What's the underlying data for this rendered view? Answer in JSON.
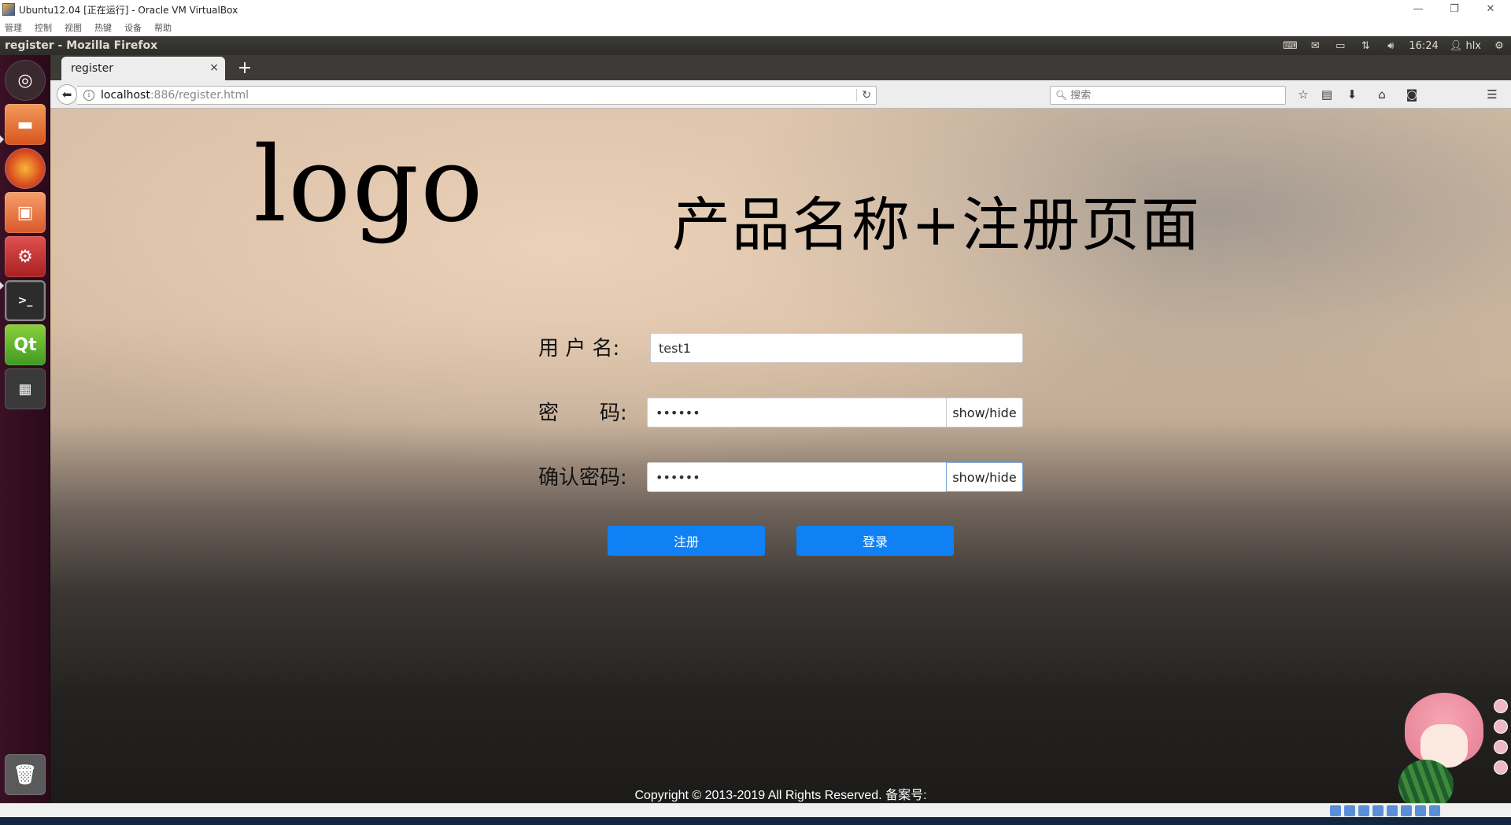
{
  "vbox": {
    "title": "Ubuntu12.04 [正在运行] - Oracle VM VirtualBox",
    "menu": [
      "管理",
      "控制",
      "视图",
      "热键",
      "设备",
      "帮助"
    ],
    "win_min": "—",
    "win_restore": "❐",
    "win_close": "✕"
  },
  "panel": {
    "window_title": "register - Mozilla Firefox",
    "clock": "16:24",
    "user": "hlx"
  },
  "browser": {
    "tab_title": "register",
    "tab_close": "×",
    "new_tab": "+",
    "url_host": "localhost",
    "url_path": ":886/register.html",
    "search_placeholder": "搜索"
  },
  "page": {
    "logo": "logo",
    "heading": "产品名称+注册页面",
    "form": {
      "username_label": "用 户 名:",
      "username_value": "test1",
      "password_label": "密　　码:",
      "password_value": "••••••",
      "confirm_label": "确认密码:",
      "confirm_value": "••••••",
      "toggle_label": "show/hide",
      "register_button": "注册",
      "login_button": "登录"
    },
    "footer": "Copyright © 2013-2019 All Rights Reserved. 备案号:"
  },
  "icons": {
    "back": "back-arrow-icon",
    "info": "info-icon",
    "reload": "reload-icon",
    "search": "search-icon",
    "bookmark": "star-icon",
    "reader": "clipboard-icon",
    "downloads": "download-icon",
    "home": "home-icon",
    "pocket": "pocket-icon",
    "menu": "hamburger-menu-icon"
  },
  "colors": {
    "primary_button": "#1081f5",
    "launcher_bg": "#2a0a1b",
    "panel_bg": "#3c3b37"
  }
}
